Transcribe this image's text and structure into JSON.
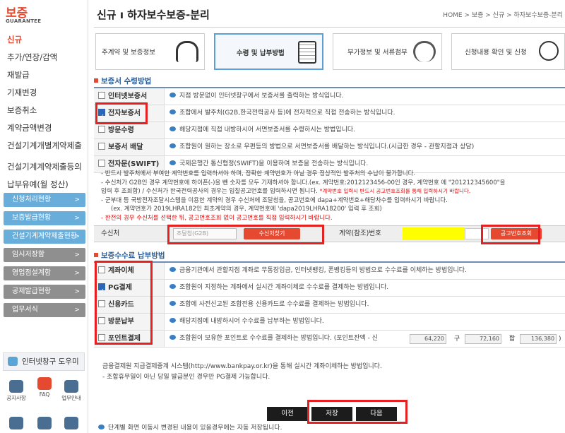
{
  "sidebar": {
    "logo_title": "보증",
    "logo_sub": "GUARANTEE",
    "menu": [
      "신규",
      "추가/연장/감액",
      "재발급",
      "기재변경",
      "보증취소",
      "계약금액변경",
      "건설기계개별계약제출",
      "건설기계계약제출등의",
      "납부유예(월 정산)"
    ],
    "buttons": [
      {
        "label": "신청처리현황",
        "color": "blue"
      },
      {
        "label": "보증발급현황",
        "color": "blue"
      },
      {
        "label": "건설기계계약제출현황",
        "color": "blue"
      },
      {
        "label": "임시저장함",
        "color": "gray"
      },
      {
        "label": "영업점설계함",
        "color": "gray"
      },
      {
        "label": "공제발급현황",
        "color": "gray"
      },
      {
        "label": "업무서식",
        "color": "gray"
      }
    ],
    "helper": "인터넷창구 도우미",
    "icons": [
      "공지사항",
      "FAQ",
      "업무안내"
    ]
  },
  "header": {
    "title": "신규 ı 하자보수보증-분리",
    "breadcrumb": "HOME > 보증 > 신규 > 하자보수보증-분리"
  },
  "steps": [
    {
      "label": "주계약 및 보증정보",
      "icon": "headphones-icon"
    },
    {
      "label": "수령 및 납부방법",
      "icon": "calculator-icon"
    },
    {
      "label": "부가정보 및 서류첨부",
      "icon": "phone-icon"
    },
    {
      "label": "신청내용 확인 및 신청",
      "icon": "hand-icon"
    }
  ],
  "receipt": {
    "title": "보증서 수령방법",
    "rows": [
      {
        "label": "인터넷보증서",
        "checked": false,
        "desc": "지점 방문없이 인터넷창구에서 보증서를 출력하는 방식입니다."
      },
      {
        "label": "전자보증서",
        "checked": true,
        "desc": "조합에서 발주처(G2B,한국전력공사 등)에 전자적으로 직접 전송하는 방식입니다."
      },
      {
        "label": "방문수령",
        "checked": false,
        "desc": "해당지점에 직접 내방하시어 서면보증서를 수령하시는 방법입니다."
      },
      {
        "label": "보증서 배달",
        "checked": false,
        "desc": "조합원이 원하는 장소로 우편등의 방법으로 서면보증서를 배달하는 방식입니다.(시급한 경우 - 관할지점과 상담)"
      },
      {
        "label": "전자문(SWIFT)",
        "checked": false,
        "desc": "국제은행간 통신협정(SWIFT)을 이용하여 보증을 전송하는 방식입니다."
      }
    ],
    "notes": [
      "- 반드시 발주처에서 부여한 계약번호를 입력하셔야 하며, 정확한 계약번호가 아닐 경우 정상적인 발주처의 수납이 불가합니다.",
      "- 수신처가 G2B인 경우 계약번호에 하이픈(-)을 뺀 숫자를 모두 기재하셔야 합니다.(ex. 계약번호:2012123456-00인 경우, 계약번호 에 \"201212345600\"을",
      "입력 후 조회함) / 수신처가 한국전력공사의 경우는 입찰공고번호를 입력하시면 됩니다.",
      "*계약번호 입력시 반드시 공고번호조회를 통해 입력하시기 바랍니다.",
      "- 군부대 등 국방전자조달시스템을 이용한 계약의 경우 수신처에 조달청을, 공고번호에 dapa+계약번호+해당차수를 입력하시기 바랍니다.",
      "(ex. 계약번호가 2019LHRA182인 최초계약의 경우, 계약번호에 'dapa2019LHRA18200' 입력 후 조회)",
      "- 한전의 경우 수신처를 선택한 뒤, 공고번호조회 없이 공고번호를 직접 입력하시기 바랍니다."
    ],
    "recipient_label": "수신처",
    "recipient_value": "조달청(G2B)",
    "recipient_btn": "수신처찾기",
    "contract_label": "계약(참조)번호",
    "contract_btn": "공고번호조회"
  },
  "payment": {
    "title": "보증수수료 납부방법",
    "rows": [
      {
        "label": "계좌이체",
        "checked": false,
        "desc": "금융기관에서 관할지점 계좌로 무통장입금, 인터넷뱅킹, 폰뱅킹등의 방법으로 수수료를 이체하는 방법입니다."
      },
      {
        "label": "PG결제",
        "checked": true,
        "desc": "조합원이 지정하는 계좌에서 실시간 계좌이체로 수수료를 결제하는 방법입니다."
      },
      {
        "label": "신용카드",
        "checked": false,
        "desc": "조합에 사전신고된 조합전용 신용카드로 수수료를 결제하는 방법입니다."
      },
      {
        "label": "방문납부",
        "checked": false,
        "desc": "해당지점에 내방하시어 수수료를 납부하는 방법입니다."
      },
      {
        "label": "포인트결제",
        "checked": false,
        "desc": "조합원이 보유한 포인트로 수수료를 결제하는 방법입니다. (포인트잔액 - 신"
      }
    ],
    "points": {
      "new_value": "64,220",
      "old_label": "구",
      "old_value": "72,160",
      "total_label": "합",
      "total_value": "136,380",
      "close": ")"
    },
    "bottom_notes": [
      "금융결제원 지급결제중계 시스템(http://www.bankpay.or.kr)을 통해 실시간 계좌이체하는 방법입니다.",
      "- 조합휴무일이 아닌 당일 발급분인 경우만 PG결제 가능합니다."
    ]
  },
  "footer": {
    "buttons": [
      "이전",
      "저장",
      "다음"
    ],
    "note": "단계별 화면 이동시 변경된 내용이 있을경우에는 자동 저장됩니다."
  },
  "highlight_color": "#e52020"
}
